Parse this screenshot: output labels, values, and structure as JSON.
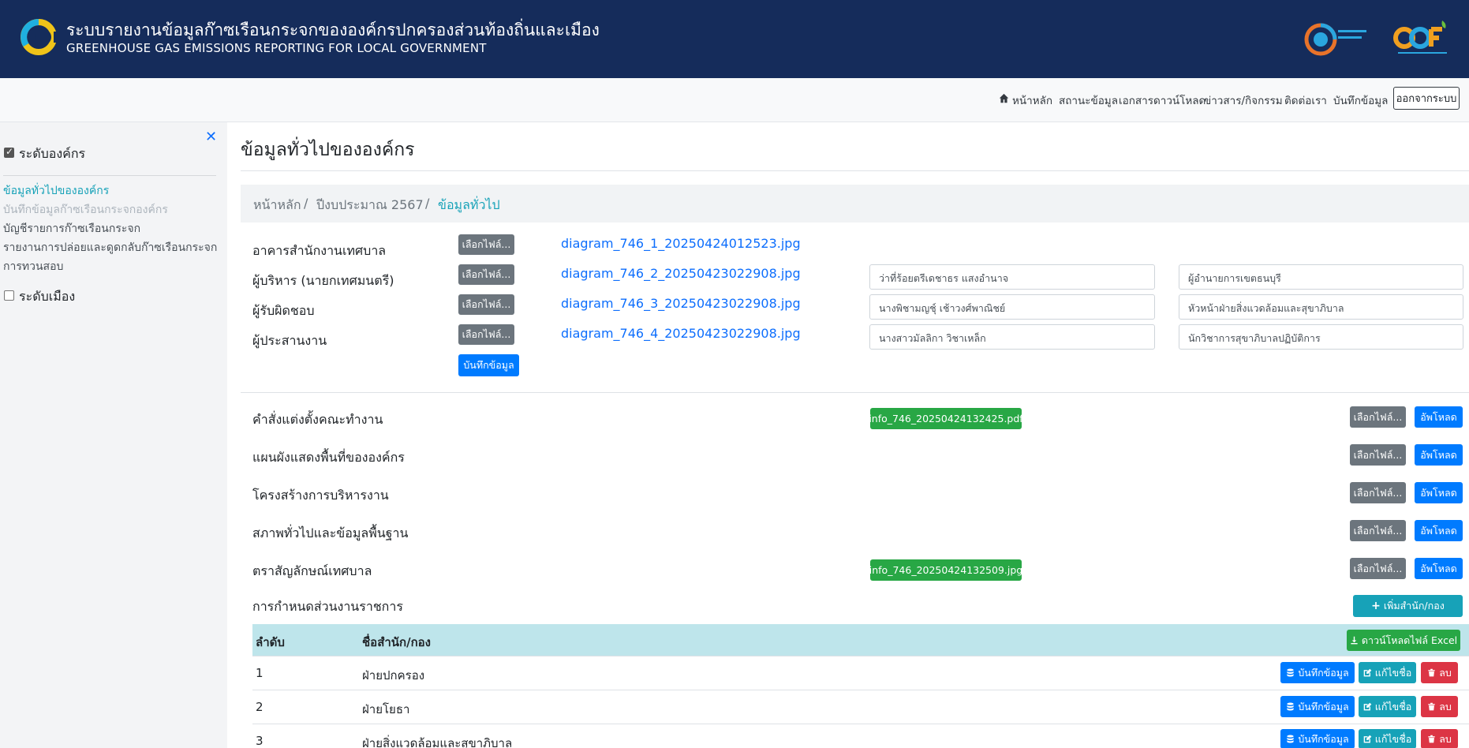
{
  "header": {
    "title_th": "ระบบรายงานข้อมูลก๊าซเรือนกระจกขององค์กรปกครองส่วนท้องถิ่นและเมือง",
    "title_en": "GREENHOUSE GAS EMISSIONS REPORTING FOR LOCAL GOVERNMENT",
    "brand_color": "#152c5b"
  },
  "nav": {
    "home": "หน้าหลัก",
    "status": "สถานะข้อมูล",
    "docs": "เอกสารดาวน์โหลด",
    "news": "ข่าวสาร/กิจกรรม",
    "contact": "ติดต่อเรา",
    "record": "บันทึกข้อมูล",
    "logout": "ออกจากระบบ"
  },
  "sidebar": {
    "org_level": "ระดับองค์กร",
    "city_level": "ระดับเมือง",
    "items": [
      "ข้อมูลทั่วไปขององค์กร",
      "บันทึกข้อมูลก๊าซเรือนกระจกองค์กร",
      "บัญชีรายการก๊าซเรือนกระจก",
      "รายงานการปล่อยและดูดกลับก๊าซเรือนกระจก",
      "การทวนสอบ"
    ]
  },
  "main": {
    "page_title": "ข้อมูลทั่วไปขององค์กร",
    "breadcrumb": [
      "หน้าหลัก",
      "/",
      "ปีงบประมาณ 2567",
      "/",
      "ข้อมูลทั่วไป"
    ],
    "choose_file": "เลือกไฟล์...",
    "save_label": "บันทึกข้อมูล",
    "people": [
      {
        "label": "อาคารสำนักงานเทศบาล",
        "file": "diagram_746_1_20250424012523.jpg",
        "name": "",
        "position": ""
      },
      {
        "label": "ผู้บริหาร (นายกเทศมนตรี)",
        "file": "diagram_746_2_20250423022908.jpg",
        "name": "ว่าที่ร้อยตรีเดชาธร แสงอำนาจ",
        "position": "ผู้อำนายการเขตธนบุรี"
      },
      {
        "label": "ผู้รับผิดชอบ",
        "file": "diagram_746_3_20250423022908.jpg",
        "name": "นางพิชามญชุ์ เช้าวงศ์พาณิชย์",
        "position": "หัวหน้าฝ่ายสิ่งแวดล้อมและสุขาภิบาล"
      },
      {
        "label": "ผู้ประสานงาน",
        "file": "diagram_746_4_20250423022908.jpg",
        "name": "นางสาวมัลลิกา วิชาเหล็ก",
        "position": "นักวิชาการสุขาภิบาลปฏิบัติการ"
      }
    ],
    "upload_label": "อัพโหลด",
    "documents": [
      {
        "label": "คำสั่งแต่งตั้งคณะทำงาน",
        "file": "info_746_20250424132425.pdf"
      },
      {
        "label": "แผนผังแสดงพื้นที่ขององค์กร",
        "file": ""
      },
      {
        "label": "โครงสร้างการบริหารงาน",
        "file": ""
      },
      {
        "label": "สภาพทั่วไปและข้อมูลพื้นฐาน",
        "file": ""
      },
      {
        "label": "ตราสัญลักษณ์เทศบาล",
        "file": "info_746_20250424132509.jpg"
      }
    ],
    "units_label": "การกำหนดส่วนงานราชการ",
    "add_unit": "เพิ่มสำนัก/กอง",
    "download_excel": "ดาวน์โหลดไฟล์ Excel",
    "table": {
      "headers": [
        "ลำดับ",
        "ชื่อสำนัก/กอง"
      ],
      "row_actions": {
        "save": "บันทึกข้อมูล",
        "edit": "แก้ไขชื่อ",
        "delete": "ลบ"
      },
      "rows": [
        {
          "no": "1",
          "name": "ฝ่ายปกครอง"
        },
        {
          "no": "2",
          "name": "ฝ่ายโยธา"
        },
        {
          "no": "3",
          "name": "ฝ่ายสิ่งแวดล้อมและสุขาภิบาล"
        }
      ]
    }
  }
}
